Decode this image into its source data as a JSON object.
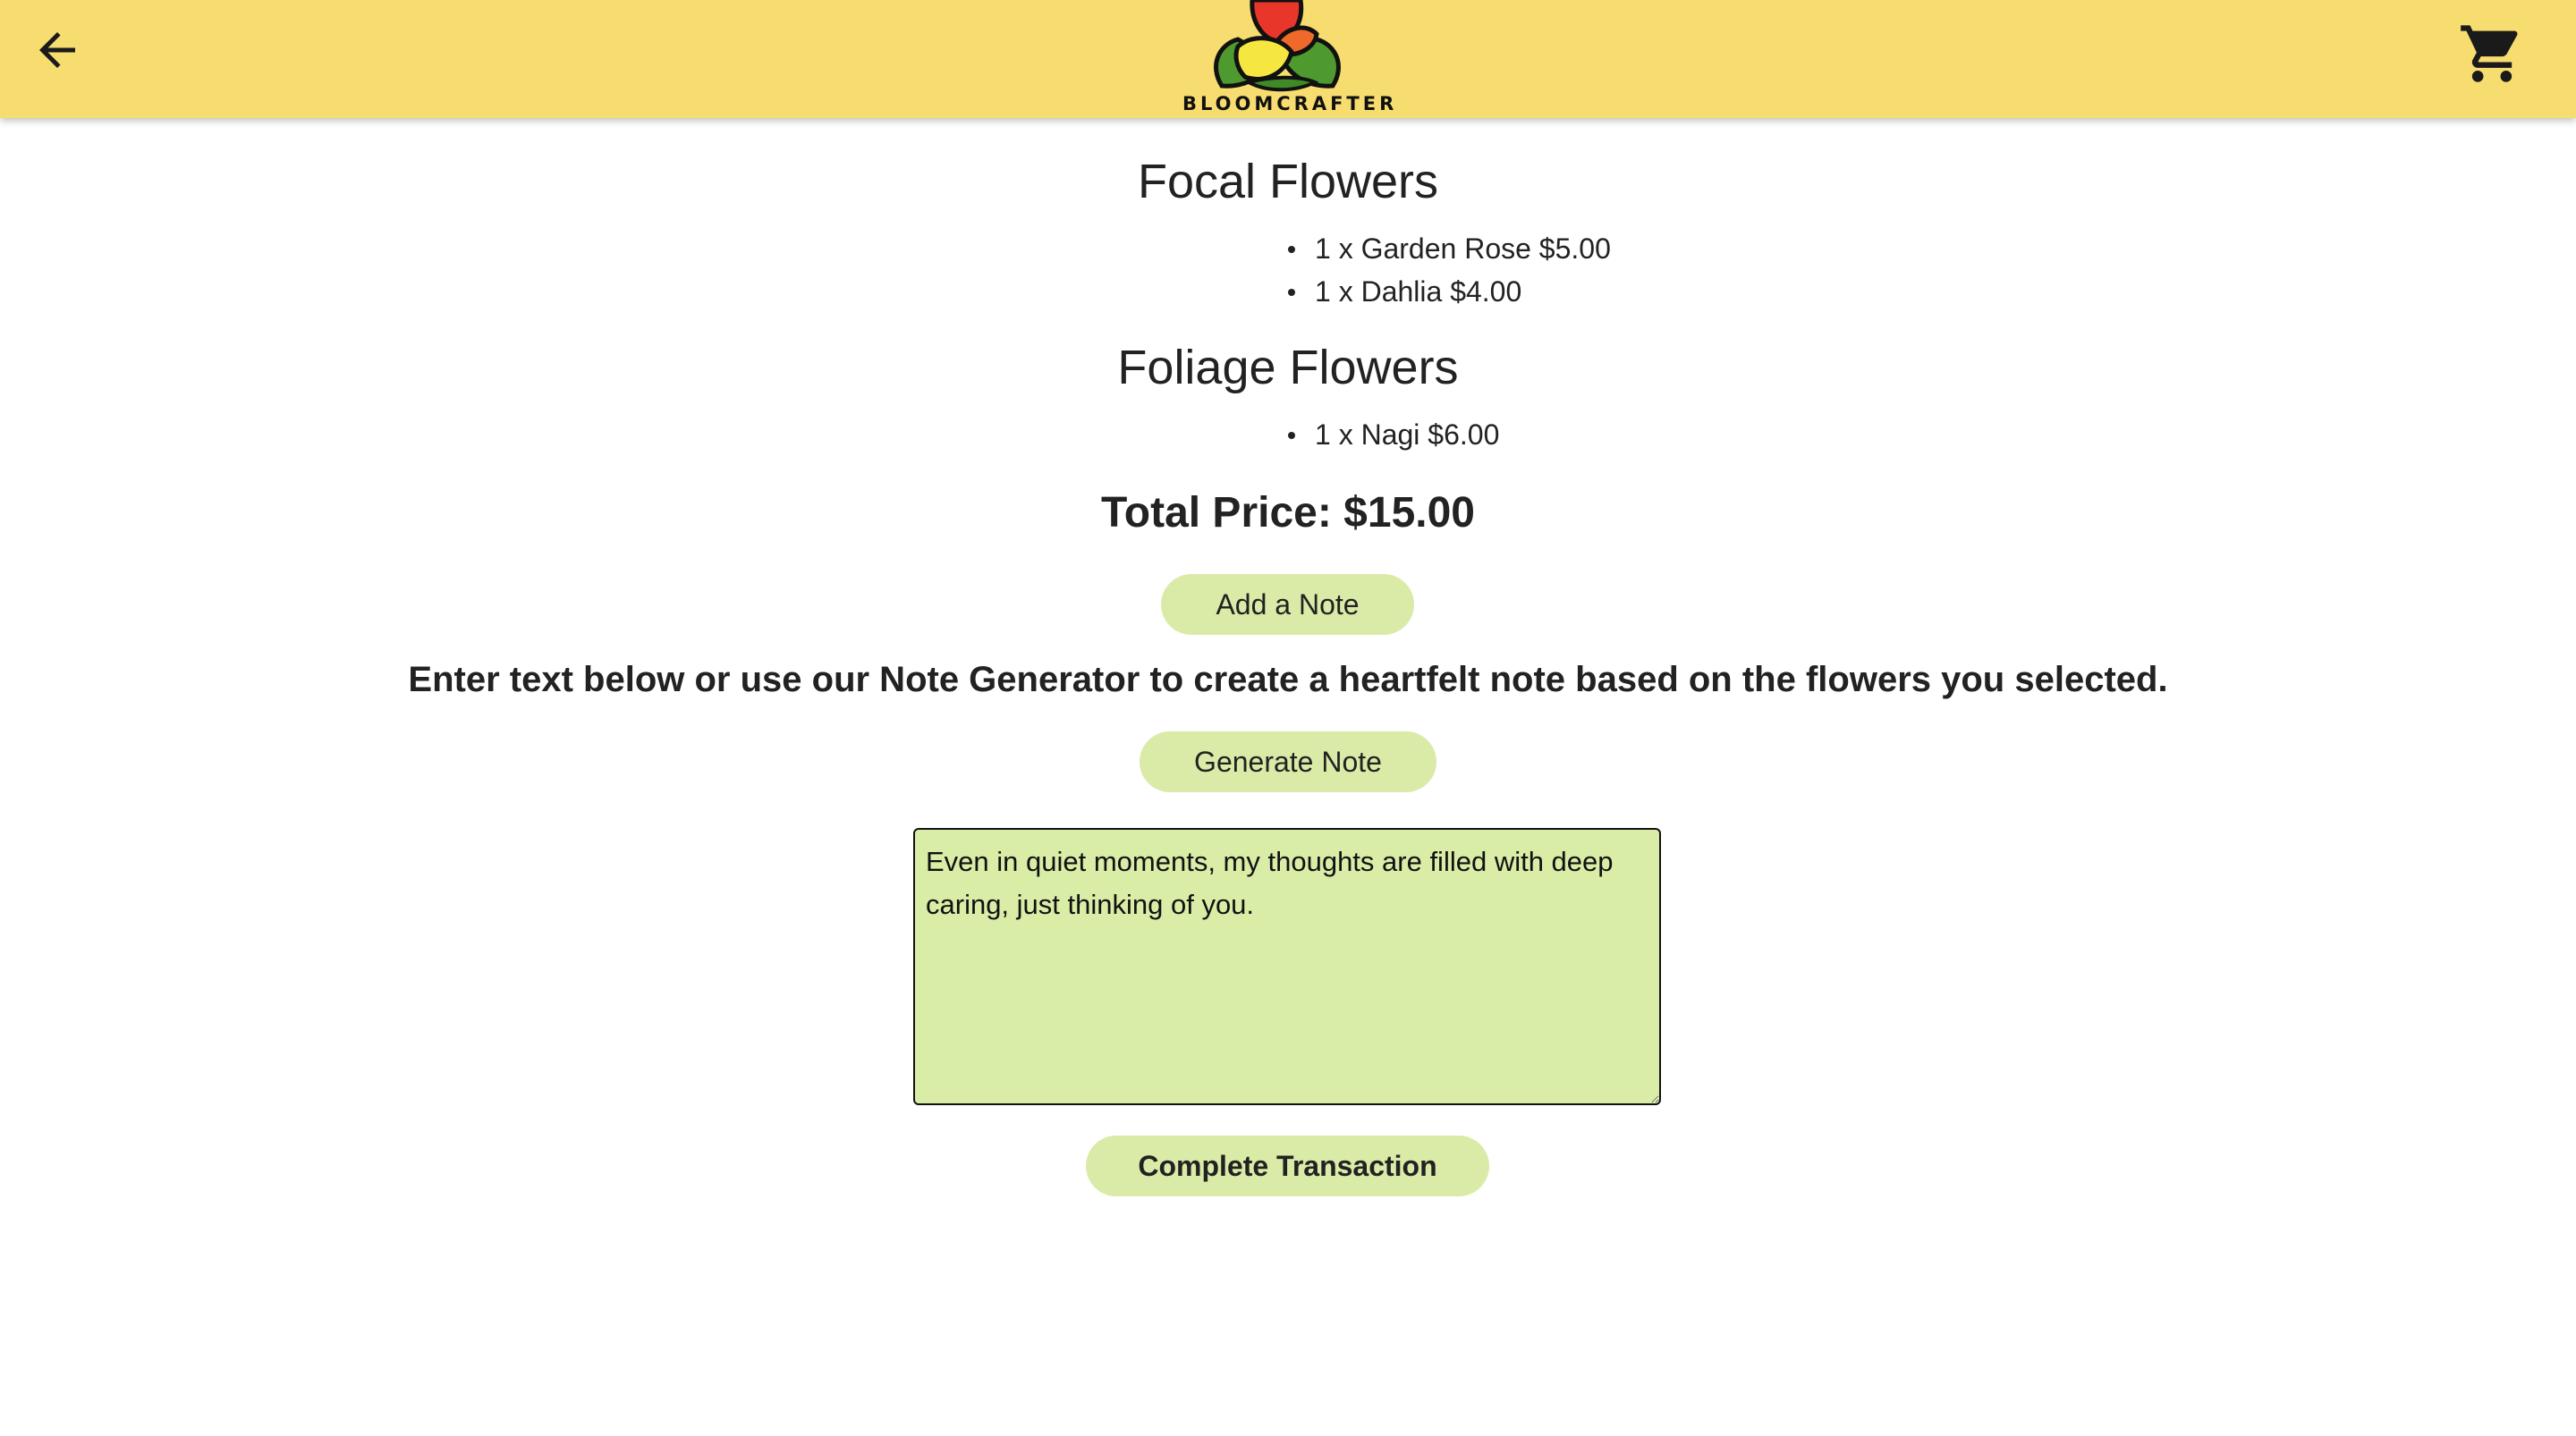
{
  "header": {
    "brand": "BLOOMCRAFTER",
    "back_icon": "arrow-left-icon",
    "cart_icon": "shopping-cart-icon",
    "background_color": "#f7dc6f"
  },
  "sections": [
    {
      "title": "Focal Flowers",
      "items": [
        "1 x Garden Rose $5.00",
        "1 x Dahlia $4.00"
      ]
    },
    {
      "title": "Foliage Flowers",
      "items": [
        "1 x Nagi $6.00"
      ]
    }
  ],
  "total_label": "Total Price: $15.00",
  "buttons": {
    "add_note": "Add a Note",
    "generate_note": "Generate Note",
    "complete_transaction": "Complete Transaction",
    "color": "#d9eba7"
  },
  "instruction": "Enter text below or use our Note Generator to create a heartfelt note based on the flowers you selected.",
  "note": {
    "value": "Even in quiet moments, my thoughts are filled with deep caring, just thinking of you."
  }
}
